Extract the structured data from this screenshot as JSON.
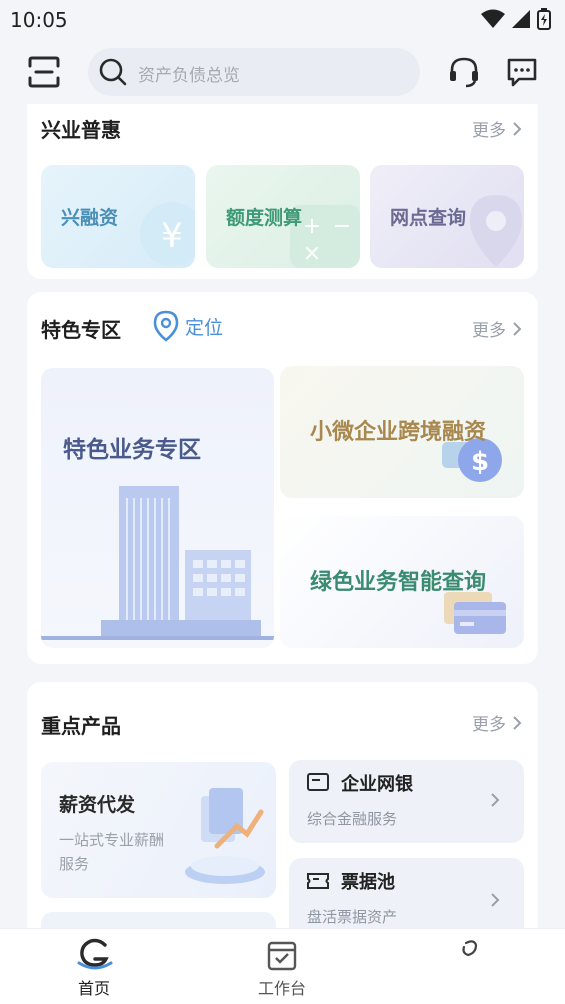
{
  "status_bar": {
    "time": "10:05"
  },
  "search": {
    "placeholder": "资产负债总览"
  },
  "xingye_puhui": {
    "title": "兴业普惠",
    "more": "更多",
    "tiles": [
      {
        "label": "兴融资",
        "color": "#4a8fb8"
      },
      {
        "label": "额度测算",
        "color": "#3f9b76"
      },
      {
        "label": "网点查询",
        "color": "#6b6a93"
      }
    ]
  },
  "featured": {
    "title": "特色专区",
    "location_label": "定位",
    "more": "更多",
    "big": {
      "title": "特色业务专区"
    },
    "small": [
      {
        "title": "小微企业跨境融资",
        "color": "#a8884e"
      },
      {
        "title": "绿色业务智能查询",
        "color": "#3a8b6f"
      }
    ]
  },
  "key_products": {
    "title": "重点产品",
    "more": "更多",
    "payroll": {
      "title": "薪资代发",
      "desc": "一站式专业薪酬服务"
    },
    "items": [
      {
        "title": "企业网银",
        "desc": "综合金融服务"
      },
      {
        "title": "票据池",
        "desc": "盘活票据资产"
      }
    ]
  },
  "tab_bar": {
    "tabs": [
      {
        "label": "首页",
        "active": true
      },
      {
        "label": "工作台",
        "active": false
      },
      {
        "label": "",
        "active": false
      }
    ]
  },
  "colors": {
    "accent": "#4a90d9",
    "active_tab": "#222222"
  }
}
